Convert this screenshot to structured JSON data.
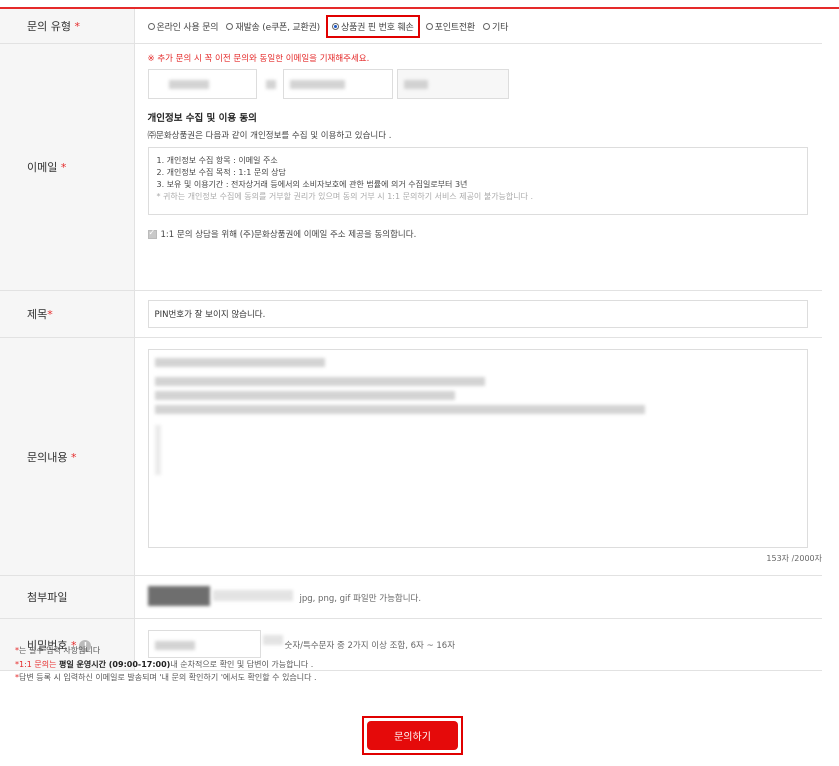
{
  "form": {
    "type": {
      "label": "문의 유형",
      "required_mark": " *",
      "options": [
        {
          "label": "온라인 사용 문의",
          "selected": false
        },
        {
          "label": "재발송 (e쿠폰, 교환권)",
          "selected": false
        },
        {
          "label": "상품권 핀 번호 훼손",
          "selected": true
        },
        {
          "label": "포인트전환",
          "selected": false
        },
        {
          "label": "기타",
          "selected": false
        }
      ]
    },
    "email": {
      "label": "이메일",
      "required_mark": " *",
      "notice": "※ 추가 문의 시 꼭 이전 문의와 동일한 이메일을 기재해주세요.",
      "privacy_title": "개인정보 수집 및 이용 동의",
      "privacy_desc": "㈜문화상품권은 다음과 같이 개인정보를 수집 및 이용하고 있습니다 .",
      "privacy_items": [
        "1. 개인정보 수집 항목 : 이메일 주소",
        "2. 개인정보 수집 목적 : 1:1 문의 상담",
        "3. 보유 및 이용기간 : 전자상거래 등에서의 소비자보호에 관한 법률에 의거 수집일로부터 3년"
      ],
      "privacy_note": "* 귀하는 개인정보 수집에 동의를 거부할 권리가 있으며 동의 거부 시 1:1 문의하기 서비스 제공이 불가능합니다 .",
      "agree_label": "1:1 문의 상담을 위해 (주)문화상품권에 이메일 주소 제공을 동의합니다."
    },
    "subject": {
      "label": "제목",
      "required_mark": "*",
      "value": "PIN번호가 잘 보이지 않습니다."
    },
    "content": {
      "label": "문의내용",
      "required_mark": " *",
      "counter": "153자 /2000자"
    },
    "attachment": {
      "label": "첨부파일",
      "hint": "jpg, png, gif 파일만 가능합니다."
    },
    "password": {
      "label": "비밀번호",
      "required_mark": " *",
      "info_icon": "!",
      "hint": "숫자/특수문자 중 2가지 이상 조합, 6자 ~ 16자"
    }
  },
  "notes": {
    "line1_mark": "*",
    "line1": "는 필수 입력 사항입니다",
    "line2_pre": "*1:1 문의는 ",
    "line2_bold": "평일 운영시간 (09:00-17:00)",
    "line2_post": "내 순차적으로 확인 및 답변이 가능합니다 .",
    "line3": "*답변 등록 시 입력하신 이메일로 발송되며 '내 문의 확인하기 '에서도 확인할 수 있습니다 ."
  },
  "submit_label": "문의하기",
  "colors": {
    "accent": "#e52a2a",
    "button": "#e50a0a",
    "highlight_box": "#e00000"
  }
}
